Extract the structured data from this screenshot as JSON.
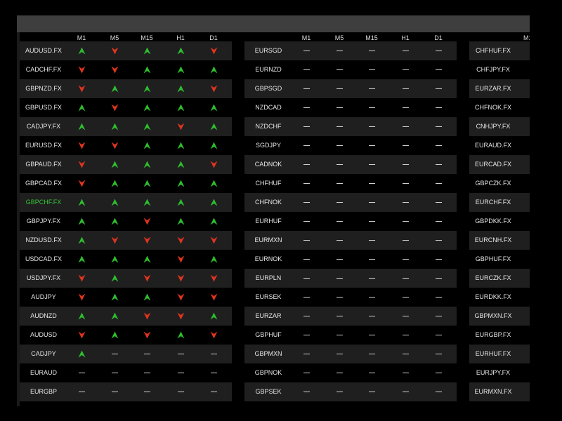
{
  "timeframes": [
    "M1",
    "M5",
    "M15",
    "H1",
    "D1"
  ],
  "colors": {
    "up": "#2ebd2e",
    "down": "#e0341f",
    "highlight": "#35c435"
  },
  "groups": [
    {
      "rows": [
        {
          "symbol": "AUDUSD.FX",
          "signals": [
            "up",
            "down",
            "up",
            "up",
            "down"
          ]
        },
        {
          "symbol": "CADCHF.FX",
          "signals": [
            "down",
            "down",
            "up",
            "up",
            "up"
          ]
        },
        {
          "symbol": "GBPNZD.FX",
          "signals": [
            "down",
            "up",
            "up",
            "up",
            "down"
          ]
        },
        {
          "symbol": "GBPUSD.FX",
          "signals": [
            "up",
            "down",
            "up",
            "up",
            "up"
          ]
        },
        {
          "symbol": "CADJPY.FX",
          "signals": [
            "up",
            "up",
            "up",
            "down",
            "up"
          ]
        },
        {
          "symbol": "EURUSD.FX",
          "signals": [
            "down",
            "down",
            "up",
            "up",
            "up"
          ]
        },
        {
          "symbol": "GBPAUD.FX",
          "signals": [
            "down",
            "up",
            "up",
            "up",
            "down"
          ]
        },
        {
          "symbol": "GBPCAD.FX",
          "signals": [
            "down",
            "up",
            "up",
            "up",
            "up"
          ]
        },
        {
          "symbol": "GBPCHF.FX",
          "highlight": true,
          "signals": [
            "up",
            "up",
            "up",
            "up",
            "up"
          ]
        },
        {
          "symbol": "GBPJPY.FX",
          "signals": [
            "up",
            "up",
            "down",
            "up",
            "up"
          ]
        },
        {
          "symbol": "NZDUSD.FX",
          "signals": [
            "up",
            "down",
            "down",
            "down",
            "down"
          ]
        },
        {
          "symbol": "USDCAD.FX",
          "signals": [
            "up",
            "up",
            "up",
            "down",
            "up"
          ]
        },
        {
          "symbol": "USDJPY.FX",
          "signals": [
            "down",
            "up",
            "down",
            "down",
            "down"
          ]
        },
        {
          "symbol": "AUDJPY",
          "signals": [
            "down",
            "up",
            "up",
            "down",
            "down"
          ]
        },
        {
          "symbol": "AUDNZD",
          "signals": [
            "up",
            "up",
            "down",
            "down",
            "up"
          ]
        },
        {
          "symbol": "AUDUSD",
          "signals": [
            "down",
            "up",
            "down",
            "up",
            "down"
          ]
        },
        {
          "symbol": "CADJPY",
          "signals": [
            "up",
            "none",
            "none",
            "none",
            "none"
          ]
        },
        {
          "symbol": "EURAUD",
          "signals": [
            "none",
            "none",
            "none",
            "none",
            "none"
          ]
        },
        {
          "symbol": "EURGBP",
          "signals": [
            "none",
            "none",
            "none",
            "none",
            "none"
          ]
        }
      ]
    },
    {
      "rows": [
        {
          "symbol": "EURSGD",
          "signals": [
            "none",
            "none",
            "none",
            "none",
            "none"
          ]
        },
        {
          "symbol": "EURNZD",
          "signals": [
            "none",
            "none",
            "none",
            "none",
            "none"
          ]
        },
        {
          "symbol": "GBPSGD",
          "signals": [
            "none",
            "none",
            "none",
            "none",
            "none"
          ]
        },
        {
          "symbol": "NZDCAD",
          "signals": [
            "none",
            "none",
            "none",
            "none",
            "none"
          ]
        },
        {
          "symbol": "NZDCHF",
          "signals": [
            "none",
            "none",
            "none",
            "none",
            "none"
          ]
        },
        {
          "symbol": "SGDJPY",
          "signals": [
            "none",
            "none",
            "none",
            "none",
            "none"
          ]
        },
        {
          "symbol": "CADNOK",
          "signals": [
            "none",
            "none",
            "none",
            "none",
            "none"
          ]
        },
        {
          "symbol": "CHFHUF",
          "signals": [
            "none",
            "none",
            "none",
            "none",
            "none"
          ]
        },
        {
          "symbol": "CHFNOK",
          "signals": [
            "none",
            "none",
            "none",
            "none",
            "none"
          ]
        },
        {
          "symbol": "EURHUF",
          "signals": [
            "none",
            "none",
            "none",
            "none",
            "none"
          ]
        },
        {
          "symbol": "EURMXN",
          "signals": [
            "none",
            "none",
            "none",
            "none",
            "none"
          ]
        },
        {
          "symbol": "EURNOK",
          "signals": [
            "none",
            "none",
            "none",
            "none",
            "none"
          ]
        },
        {
          "symbol": "EURPLN",
          "signals": [
            "none",
            "none",
            "none",
            "none",
            "none"
          ]
        },
        {
          "symbol": "EURSEK",
          "signals": [
            "none",
            "none",
            "none",
            "none",
            "none"
          ]
        },
        {
          "symbol": "EURZAR",
          "signals": [
            "none",
            "none",
            "none",
            "none",
            "none"
          ]
        },
        {
          "symbol": "GBPHUF",
          "signals": [
            "none",
            "none",
            "none",
            "none",
            "none"
          ]
        },
        {
          "symbol": "GBPMXN",
          "signals": [
            "none",
            "none",
            "none",
            "none",
            "none"
          ]
        },
        {
          "symbol": "GBPNOK",
          "signals": [
            "none",
            "none",
            "none",
            "none",
            "none"
          ]
        },
        {
          "symbol": "GBPSEK",
          "signals": [
            "none",
            "none",
            "none",
            "none",
            "none"
          ]
        }
      ]
    },
    {
      "rows": [
        {
          "symbol": "CHFHUF.FX",
          "signals": [
            "none",
            "none",
            "none",
            "none",
            "none"
          ]
        },
        {
          "symbol": "CHFJPY.FX",
          "signals": [
            "none",
            "none",
            "none",
            "none",
            "none"
          ]
        },
        {
          "symbol": "EURZAR.FX",
          "signals": [
            "none",
            "none",
            "none",
            "none",
            "none"
          ]
        },
        {
          "symbol": "CHFNOK.FX",
          "signals": [
            "none",
            "none",
            "none",
            "none",
            "none"
          ]
        },
        {
          "symbol": "CNHJPY.FX",
          "signals": [
            "none",
            "none",
            "none",
            "none",
            "none"
          ]
        },
        {
          "symbol": "EURAUD.FX",
          "signals": [
            "none",
            "none",
            "none",
            "none",
            "none"
          ]
        },
        {
          "symbol": "EURCAD.FX",
          "signals": [
            "none",
            "none",
            "none",
            "none",
            "none"
          ]
        },
        {
          "symbol": "GBPCZK.FX",
          "signals": [
            "none",
            "none",
            "none",
            "none",
            "none"
          ]
        },
        {
          "symbol": "EURCHF.FX",
          "signals": [
            "none",
            "none",
            "none",
            "none",
            "none"
          ]
        },
        {
          "symbol": "GBPDKK.FX",
          "signals": [
            "none",
            "none",
            "none",
            "none",
            "none"
          ]
        },
        {
          "symbol": "EURCNH.FX",
          "signals": [
            "none",
            "none",
            "none",
            "none",
            "none"
          ]
        },
        {
          "symbol": "GBPHUF.FX",
          "signals": [
            "none",
            "none",
            "none",
            "none",
            "none"
          ]
        },
        {
          "symbol": "EURCZK.FX",
          "signals": [
            "none",
            "none",
            "none",
            "none",
            "none"
          ]
        },
        {
          "symbol": "EURDKK.FX",
          "signals": [
            "none",
            "none",
            "none",
            "none",
            "none"
          ]
        },
        {
          "symbol": "GBPMXN.FX",
          "signals": [
            "none",
            "none",
            "none",
            "none",
            "none"
          ]
        },
        {
          "symbol": "EURGBP.FX",
          "signals": [
            "none",
            "none",
            "none",
            "none",
            "none"
          ]
        },
        {
          "symbol": "EURHUF.FX",
          "signals": [
            "none",
            "none",
            "none",
            "none",
            "none"
          ]
        },
        {
          "symbol": "EURJPY.FX",
          "signals": [
            "none",
            "none",
            "none",
            "none",
            "none"
          ]
        },
        {
          "symbol": "EURMXN.FX",
          "signals": [
            "none",
            "none",
            "none",
            "none",
            "none"
          ]
        }
      ]
    }
  ]
}
